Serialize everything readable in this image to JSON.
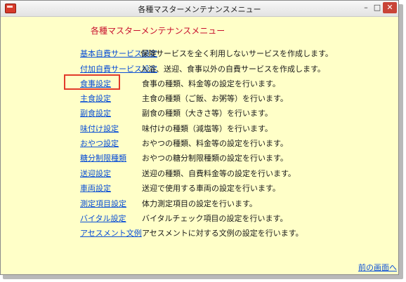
{
  "window": {
    "title": "各種マスターメンテナンスメニュー",
    "controls": {
      "minimize": "–",
      "maximize": "□",
      "close": "✕"
    }
  },
  "heading": "各種マスターメンテナンスメニュー",
  "menu": [
    {
      "label": "基本自費サービス設定",
      "desc": "保険サービスを全く利用しないサービスを作成します。"
    },
    {
      "label": "付加自費サービス設定",
      "desc": "入浴、送迎、食事以外の自費サービスを作成します。"
    },
    {
      "label": "食事設定",
      "desc": "食事の種類、料金等の設定を行います。"
    },
    {
      "label": "主食設定",
      "desc": "主食の種類（ご飯、お粥等）を行います。"
    },
    {
      "label": "副食設定",
      "desc": "副食の種類（大きさ等）を行います。"
    },
    {
      "label": "味付け設定",
      "desc": "味付けの種類（減塩等）を行います。"
    },
    {
      "label": "おやつ設定",
      "desc": "おやつの種類、料金等の設定を行います。"
    },
    {
      "label": "糖分制限種類",
      "desc": "おやつの糖分制限種類の設定を行います。"
    },
    {
      "label": "送迎設定",
      "desc": "送迎の種類、自費料金等の設定を行います。"
    },
    {
      "label": "車両設定",
      "desc": "送迎で使用する車両の設定を行います。"
    },
    {
      "label": "測定項目設定",
      "desc": "体力測定項目の設定を行います。"
    },
    {
      "label": "バイタル設定",
      "desc": "バイタルチェック項目の設定を行います。"
    },
    {
      "label": "アセスメント文例",
      "desc": "アセスメントに対する文例の設定を行います。"
    }
  ],
  "back_link": "前の画面へ",
  "highlight_color": "#e23b2a",
  "link_color": "#0b4fd6"
}
